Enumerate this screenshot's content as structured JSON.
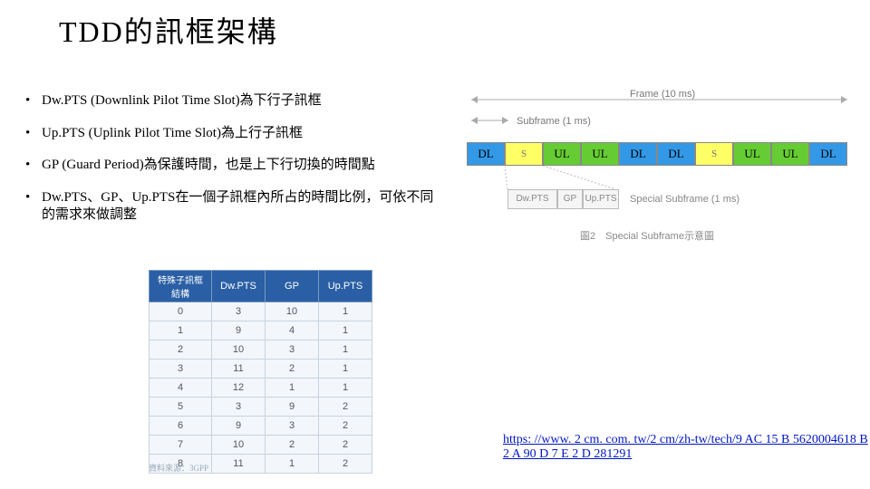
{
  "title": "TDD的訊框架構",
  "bullets": [
    "Dw.PTS (Downlink Pilot Time Slot)為下行子訊框",
    "Up.PTS (Uplink Pilot Time Slot)為上行子訊框",
    "GP (Guard Period)為保護時間，也是上下行切換的時間點",
    "Dw.PTS、GP、Up.PTS在一個子訊框內所占的時間比例，可依不同的需求來做調整"
  ],
  "frame": {
    "frame_label": "Frame (10 ms)",
    "subframe_label": "Subframe (1 ms)",
    "cells": [
      {
        "t": "DL",
        "c": "dl"
      },
      {
        "t": "S",
        "c": "s"
      },
      {
        "t": "UL",
        "c": "ul"
      },
      {
        "t": "UL",
        "c": "ul"
      },
      {
        "t": "DL",
        "c": "dl"
      },
      {
        "t": "DL",
        "c": "dl"
      },
      {
        "t": "S",
        "c": "s"
      },
      {
        "t": "UL",
        "c": "ul"
      },
      {
        "t": "UL",
        "c": "ul"
      },
      {
        "t": "DL",
        "c": "dl"
      }
    ],
    "special": {
      "labels": [
        "Dw.PTS",
        "GP",
        "Up.PTS"
      ],
      "caption": "Special Subframe (1 ms)"
    },
    "figcap": "圖2　Special Subframe示意圖"
  },
  "table": {
    "headers": [
      "特殊子訊框結構",
      "Dw.PTS",
      "GP",
      "Up.PTS"
    ],
    "rows": [
      [
        "0",
        "3",
        "10",
        "1"
      ],
      [
        "1",
        "9",
        "4",
        "1"
      ],
      [
        "2",
        "10",
        "3",
        "1"
      ],
      [
        "3",
        "11",
        "2",
        "1"
      ],
      [
        "4",
        "12",
        "1",
        "1"
      ],
      [
        "5",
        "3",
        "9",
        "2"
      ],
      [
        "6",
        "9",
        "3",
        "2"
      ],
      [
        "7",
        "10",
        "2",
        "2"
      ],
      [
        "8",
        "11",
        "1",
        "2"
      ]
    ],
    "source": "資料來源：3GPP"
  },
  "link": {
    "text": "https: //www. 2 cm. com. tw/2 cm/zh-tw/tech/9 AC 15 B 5620004618 B 2 A 90 D 7 E 2 D 281291",
    "href": "https://www.2cm.com.tw/2cm/zh-tw/tech/9AC15B5620004618B2A90D7E2D281291"
  }
}
